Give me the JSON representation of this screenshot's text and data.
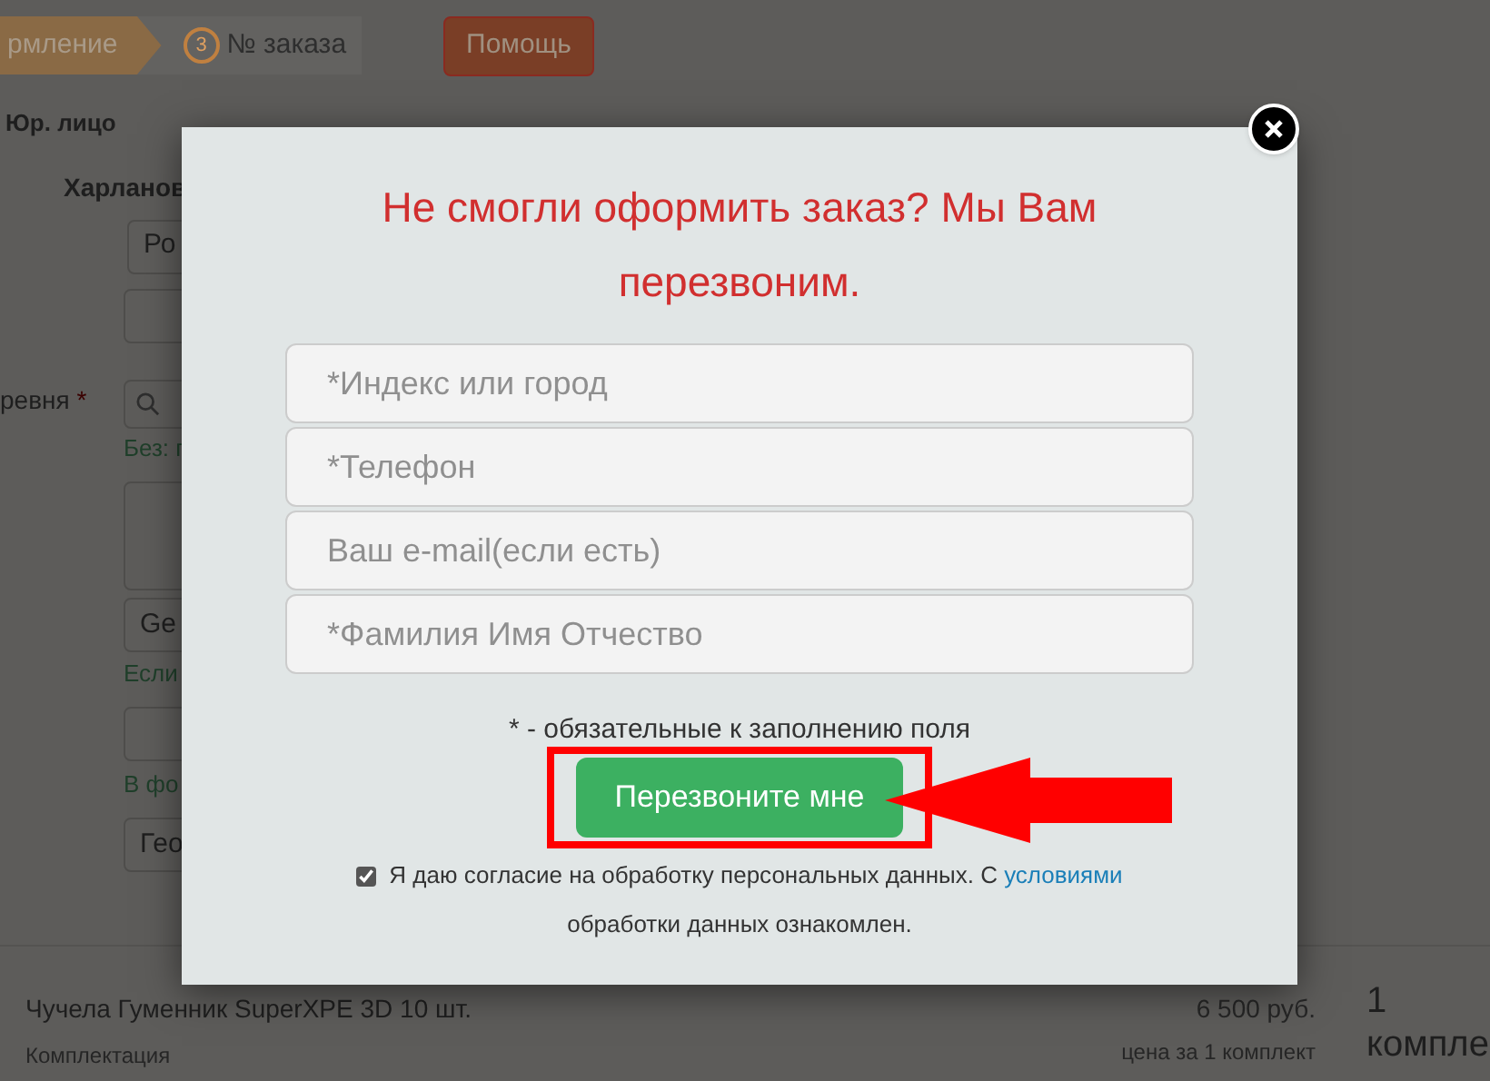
{
  "steps": [
    {
      "label": "рмление",
      "selected": true
    },
    {
      "number": "3",
      "label": "№ заказа",
      "selected": false
    }
  ],
  "help_button": "Помощь",
  "form": {
    "entity_label": "Юр. лицо",
    "name_label": "Харланов",
    "field_1": "Ро",
    "village_label": "ревня",
    "required_mark": "*",
    "search_hint": "Без: г",
    "field_2": "Ge",
    "hint_2": "Если",
    "hint_3": "В фо",
    "field_3": "Гео"
  },
  "product": {
    "name": "Чучела Гуменник SuperXPE 3D 10 шт.",
    "subtitle": "Комплектация",
    "price": "6 500 руб.",
    "price_note": "цена за 1 комплект",
    "qty": "1",
    "unit": "компле"
  },
  "modal": {
    "title": "Не смогли оформить заказ? Мы Вам перезвоним.",
    "fields": [
      {
        "placeholder": "*Индекс или город"
      },
      {
        "placeholder": "*Телефон"
      },
      {
        "placeholder": "Ваш e-mail(если есть)"
      },
      {
        "placeholder": "*Фамилия Имя Отчество"
      }
    ],
    "note": "* - обязательные к заполнению поля",
    "submit": "Перезвоните мне",
    "highlighted": true,
    "consent": {
      "checked": true,
      "text_before": "Я даю согласие на обработку персональных данных. С ",
      "link": "условиями",
      "text_after": " обработки данных ознакомлен."
    }
  }
}
